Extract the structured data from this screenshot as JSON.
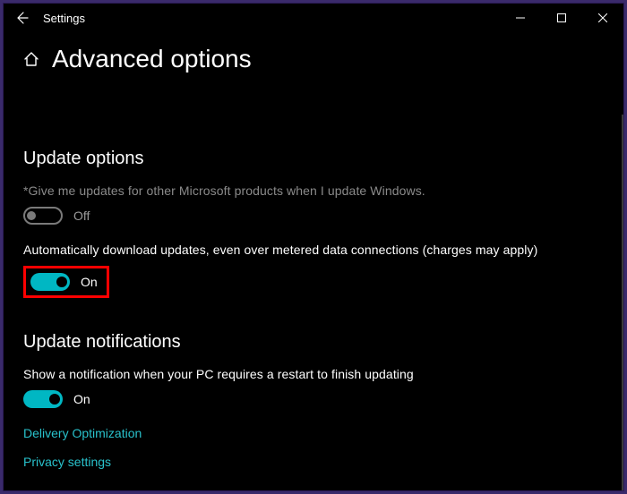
{
  "titlebar": {
    "app_name": "Settings"
  },
  "page": {
    "title": "Advanced options"
  },
  "sections": {
    "update_options": {
      "heading": "Update options",
      "item1": {
        "label": "*Give me updates for other Microsoft products when I update Windows.",
        "state": "Off"
      },
      "item2": {
        "label": "Automatically download updates, even over metered data connections (charges may apply)",
        "state": "On"
      }
    },
    "update_notifications": {
      "heading": "Update notifications",
      "item1": {
        "label": "Show a notification when your PC requires a restart to finish updating",
        "state": "On"
      }
    }
  },
  "links": {
    "delivery_optimization": "Delivery Optimization",
    "privacy_settings": "Privacy settings"
  }
}
